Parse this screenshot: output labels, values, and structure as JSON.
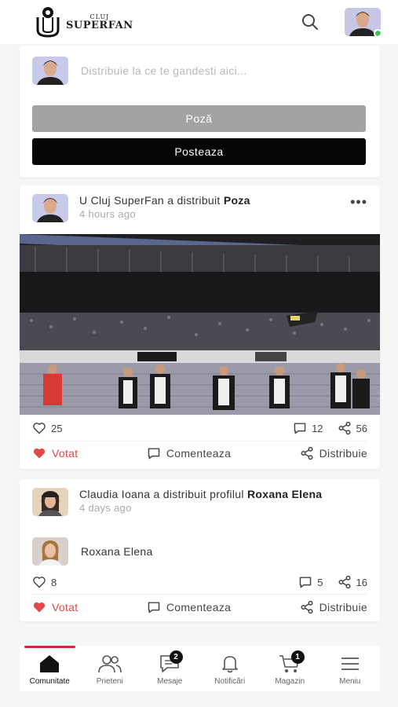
{
  "header": {
    "logo_small": "CLUJ",
    "logo_big": "SUPERFAN",
    "logo_monogram": "U"
  },
  "composer": {
    "placeholder": "Distribuie la ce te gandesti aici...",
    "photo_button": "Poză",
    "post_button": "Posteaza"
  },
  "posts": [
    {
      "author": "U Cluj SuperFan",
      "action": "a distribuit",
      "object": "Poza",
      "time": "4 hours ago",
      "likes": "25",
      "comments": "12",
      "shares": "56",
      "vote_label": "Votat",
      "comment_label": "Comenteaza",
      "share_label": "Distribuie"
    },
    {
      "author": "Claudia Ioana",
      "action": "a distribuit profilul",
      "object": "Roxana Elena",
      "time": "4 days ago",
      "shared_profile_name": "Roxana Elena",
      "likes": "8",
      "comments": "5",
      "shares": "16",
      "vote_label": "Votat",
      "comment_label": "Comenteaza",
      "share_label": "Distribuie"
    }
  ],
  "nav": {
    "items": [
      {
        "label": "Comunitate",
        "icon": "home-icon",
        "active": true
      },
      {
        "label": "Prieteni",
        "icon": "friends-icon"
      },
      {
        "label": "Mesaje",
        "icon": "chat-icon",
        "badge": "2"
      },
      {
        "label": "Notificări",
        "icon": "bell-icon"
      },
      {
        "label": "Magazin",
        "icon": "cart-icon",
        "badge": "1"
      },
      {
        "label": "Meniu",
        "icon": "menu-icon"
      }
    ]
  },
  "colors": {
    "accent": "#c4303b",
    "voted": "#e04a4a",
    "online": "#3cc35a",
    "photo_button": "#a3a3a3",
    "post_button": "#050505"
  }
}
